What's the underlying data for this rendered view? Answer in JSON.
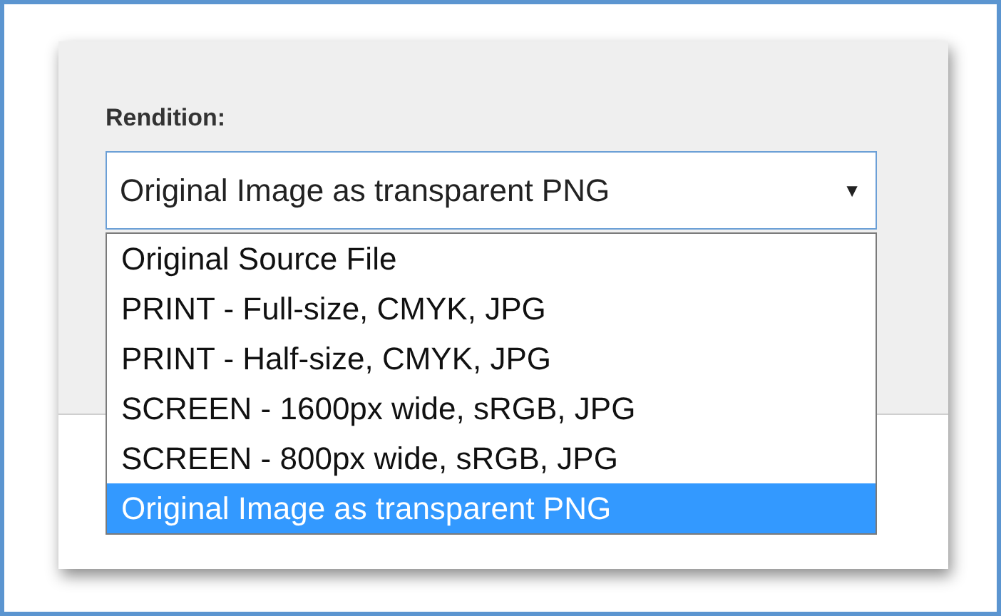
{
  "field": {
    "label": "Rendition:",
    "value": "Original Image as transparent PNG",
    "arrow": "▼",
    "expanded": true
  },
  "options": [
    {
      "label": "Original Source File",
      "selected": false
    },
    {
      "label": "PRINT - Full-size, CMYK, JPG",
      "selected": false
    },
    {
      "label": "PRINT - Half-size, CMYK, JPG",
      "selected": false
    },
    {
      "label": "SCREEN - 1600px wide, sRGB, JPG",
      "selected": false
    },
    {
      "label": "SCREEN - 800px wide, sRGB, JPG",
      "selected": false
    },
    {
      "label": "Original Image as transparent PNG",
      "selected": true
    }
  ]
}
